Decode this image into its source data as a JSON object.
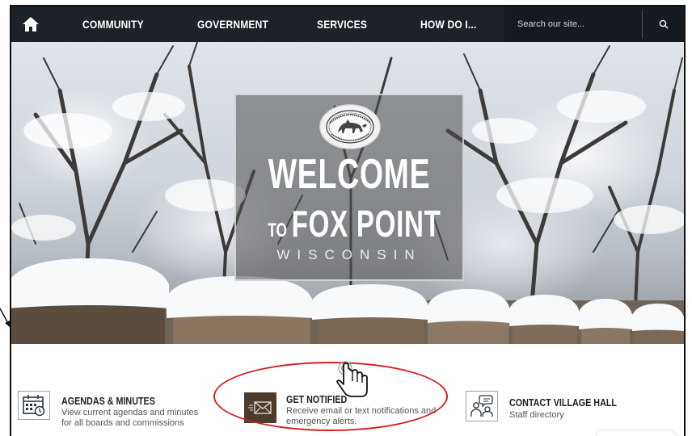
{
  "nav": {
    "items": [
      {
        "label": "COMMUNITY"
      },
      {
        "label": "GOVERNMENT"
      },
      {
        "label": "SERVICES"
      },
      {
        "label": "HOW DO I..."
      }
    ],
    "search": {
      "placeholder": "Search our site..."
    }
  },
  "hero": {
    "welcome": "WELCOME",
    "to": "TO",
    "fox_point": "FOX POINT",
    "wisconsin": "WISCONSIN",
    "seal_top_text": "VILLAGE OF FOX POINT",
    "seal_bottom_text": "FOX POINT, WISCONSIN"
  },
  "quick_links": [
    {
      "title": "AGENDAS & MINUTES",
      "description": "View current agendas and minutes for all boards and commissions",
      "icon": "calendar-icon"
    },
    {
      "title": "GET NOTIFIED",
      "description": "Receive email or text notifications and emergency alerts.",
      "icon": "envelope-icon"
    },
    {
      "title": "CONTACT VILLAGE HALL",
      "description": "Staff directory",
      "icon": "people-chat-icon"
    }
  ],
  "colors": {
    "nav_bg": "#1d2128",
    "highlight_circle": "#d42020",
    "notify_icon_bg": "#4a3b2c"
  }
}
